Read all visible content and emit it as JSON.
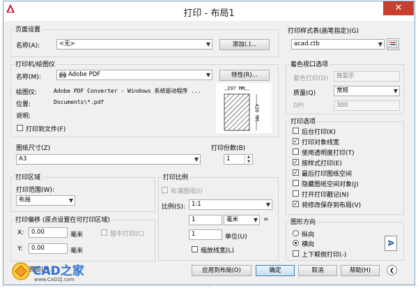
{
  "window": {
    "title": "打印 - 布局1",
    "close_glyph": "✕"
  },
  "page_setup": {
    "group": "页面设置",
    "name_label": "名称(A):",
    "name_value": "<无>",
    "add_button": "添加(.)..."
  },
  "printer": {
    "group": "打印机/绘图仪",
    "name_label": "名称(M):",
    "name_value": "Adobe PDF",
    "properties_button": "特性(R)...",
    "plotter_label": "绘图仪:",
    "plotter_value": "Adobe PDF Converter - Windows 系统驱动程序 ...",
    "location_label": "位置:",
    "location_value": "Documents\\*.pdf",
    "description_label": "说明:",
    "print_to_file": "打印到文件(F)",
    "preview_width": "297 MM",
    "preview_height": "420 MM"
  },
  "paper_size": {
    "group": "图纸尺寸(Z)",
    "value": "A3"
  },
  "copies": {
    "group": "打印份数(B)",
    "value": "1"
  },
  "plot_area": {
    "group": "打印区域",
    "range_label": "打印范围(W):",
    "range_value": "布局"
  },
  "plot_scale": {
    "group": "打印比例",
    "fit_paper": "布满图纸(I)",
    "scale_label": "比例(S):",
    "scale_value": "1:1",
    "numerator": "1",
    "unit_value": "毫米",
    "equals": "=",
    "denominator": "1",
    "unit_label": "单位(U)",
    "scale_lineweights": "缩放线宽(L)"
  },
  "plot_offset": {
    "group": "打印偏移 (原点设置在可打印区域)",
    "x_label": "X:",
    "x_value": "0.00",
    "x_unit": "毫米",
    "center_plot": "居中打印(C)",
    "y_label": "Y:",
    "y_value": "0.00",
    "y_unit": "毫米"
  },
  "plot_style_table": {
    "group": "打印样式表(画笔指定)(G)",
    "value": "acad.ctb"
  },
  "shaded_viewport": {
    "group": "着色视口选项",
    "shade_label": "着色打印(D)",
    "shade_value": "按显示",
    "quality_label": "质量(Q)",
    "quality_value": "常规",
    "dpi_label": "DPI",
    "dpi_value": "300"
  },
  "plot_options": {
    "group": "打印选项",
    "items": [
      {
        "label": "后台打印(K)",
        "checked": false
      },
      {
        "label": "打印对象线宽",
        "checked": true
      },
      {
        "label": "使用透明度打印(T)",
        "checked": false
      },
      {
        "label": "按样式打印(E)",
        "checked": true
      },
      {
        "label": "最后打印图纸空间",
        "checked": true
      },
      {
        "label": "隐藏图纸空间对象(J)",
        "checked": false
      },
      {
        "label": "打开打印戳记(N)",
        "checked": false
      },
      {
        "label": "将修改保存到布局(V)",
        "checked": true
      }
    ],
    "check_glyph": "✓"
  },
  "orientation": {
    "group": "图形方向",
    "portrait": "纵向",
    "landscape": "横向",
    "upside_down": "上下颠倒打印(-)",
    "icon_letter": "A"
  },
  "footer": {
    "preview_button": "预览(P)...",
    "apply_button": "应用到布局(O)",
    "ok_button": "确定",
    "cancel_button": "取消",
    "help_button": "帮助(H)",
    "collapse_glyph": "❮"
  },
  "watermark": {
    "brand": "CAD之家",
    "url": "www.CADZJ.com"
  },
  "colors": {
    "accent": "#3c7fb1",
    "close": "#c7402e",
    "dialog_bg": "#f0f0f0"
  }
}
